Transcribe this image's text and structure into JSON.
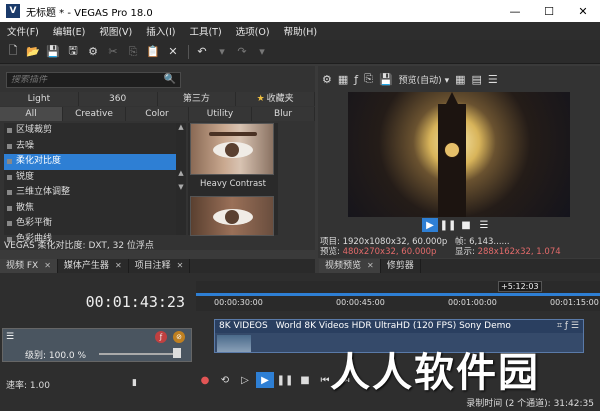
{
  "window": {
    "title": "无标题 * - VEGAS Pro 18.0",
    "app_badge": "V",
    "controls": [
      "—",
      "☐",
      "✕"
    ]
  },
  "menu": [
    "文件(F)",
    "编辑(E)",
    "视图(V)",
    "插入(I)",
    "工具(T)",
    "选项(O)",
    "帮助(H)"
  ],
  "toolbar": {
    "icons": [
      "new-icon",
      "open-icon",
      "save-icon",
      "save-as-icon",
      "gear-icon",
      "cut-icon",
      "copy-icon",
      "paste-icon",
      "delete-icon",
      "undo-icon",
      "redo-icon"
    ]
  },
  "fx_browser": {
    "search_placeholder": "搜索插件",
    "categories_row1": [
      "Light",
      "360",
      "第三方",
      "收藏夹"
    ],
    "categories_row2": [
      "All",
      "Creative",
      "Color",
      "Utility",
      "Blur"
    ],
    "items": [
      "区域裁剪",
      "去噪",
      "柔化对比度",
      "锐度",
      "三维立体调整",
      "散焦",
      "色彩平衡",
      "色彩曲线"
    ],
    "selected_item": "柔化对比度",
    "preset_label": "Heavy Contrast",
    "status": "VEGAS 柔化对比度: DXT, 32 位浮点"
  },
  "left_tabs": [
    {
      "label": "视频 FX",
      "close": "✕"
    },
    {
      "label": "媒体产生器",
      "close": "✕"
    },
    {
      "label": "项目注释",
      "close": "✕"
    }
  ],
  "preview": {
    "dropdown": "预览(自动)",
    "transport": [
      "▶",
      "❚❚",
      "■",
      "☰"
    ],
    "info": {
      "project_label": "项目:",
      "project_value": "1920x1080x32, 60.000p",
      "frame_label": "帧:",
      "frame_value": "6,143......",
      "preview_label": "预览:",
      "preview_value": "480x270x32, 60.000p",
      "display_label": "显示:",
      "display_value": "288x162x32, 1.074"
    }
  },
  "right_tabs": [
    {
      "label": "视频预览",
      "close": "✕"
    },
    {
      "label": "修剪器",
      "close": ""
    }
  ],
  "timeline": {
    "timecode": "00:01:43:23",
    "marker": "+5:12:03",
    "ticks": [
      "00:00:30:00",
      "00:00:45:00",
      "00:01:00:00",
      "00:01:15:00"
    ],
    "track_level": "级别: 100.0 %",
    "rate": "速率: 1.00",
    "clip": {
      "name": "8K VIDEOS",
      "title": "World 8K Videos HDR UltraHD  (120 FPS)  Sony Demo"
    },
    "record_time": "录制时间 (2 个通道): 31:42:35"
  },
  "overlay": "人人软件园",
  "colors": {
    "accent": "#2e7fd4",
    "background": "#333333"
  }
}
